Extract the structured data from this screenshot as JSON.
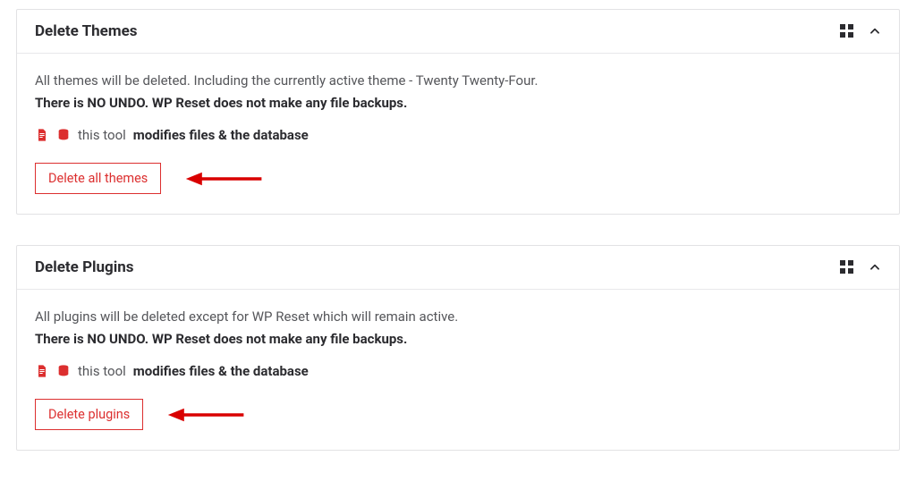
{
  "panels": [
    {
      "id": "themes",
      "title": "Delete Themes",
      "description": "All themes will be deleted. Including the currently active theme - Twenty Twenty-Four.",
      "warning": "There is NO UNDO. WP Reset does not make any file backups.",
      "modifies_prefix": "this tool",
      "modifies_strong": "modifies files & the database",
      "button_label": "Delete all themes"
    },
    {
      "id": "plugins",
      "title": "Delete Plugins",
      "description": "All plugins will be deleted except for WP Reset which will remain active.",
      "warning": "There is NO UNDO. WP Reset does not make any file backups.",
      "modifies_prefix": "this tool",
      "modifies_strong": "modifies files & the database",
      "button_label": "Delete plugins"
    }
  ],
  "colors": {
    "danger": "#dc2f2f"
  }
}
